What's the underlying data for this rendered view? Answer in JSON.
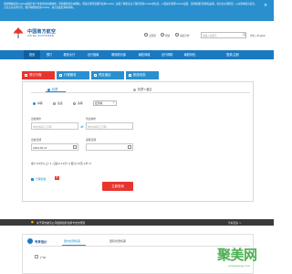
{
  "cookie_notice": {
    "text": "南航网站使用cookie来提升和个性化您的在线体验，若您继续浏览本网站，则表示您同意我们使用cookie。如需了解更多关于我们使用cookie的信息，以及如何管理cookie设置，请查看我们的隐私政策。请点击关闭按钮，以关闭本提示信息，无论点击关闭与否，我们将继续使用cookie。请点击此处查看详情。",
    "close_label": "×"
  },
  "header": {
    "logo_cn": "中国南方航空",
    "logo_en": "CHINA SOUTHERN",
    "links": [
      {
        "label": "无障碍"
      },
      {
        "label": "帮助"
      },
      {
        "label": "南航合作"
      }
    ],
    "search_placeholder": "请输入关键字",
    "language": "中文 | English"
  },
  "nav": {
    "items": [
      {
        "label": "首页"
      },
      {
        "label": "预订"
      },
      {
        "label": "服务大厅"
      },
      {
        "label": "出行指南"
      },
      {
        "label": "明珠俱乐部"
      },
      {
        "label": "南航商城"
      },
      {
        "label": "出行帮助"
      },
      {
        "label": "南航特色"
      }
    ],
    "login_label": "登录|注册"
  },
  "booking": {
    "tabs": [
      {
        "label": "预订行程"
      },
      {
        "label": "行程服务"
      },
      {
        "label": "预定酒店"
      },
      {
        "label": "航班动态"
      }
    ],
    "subtabs": [
      {
        "label": "机票"
      },
      {
        "label": "机票+酒店"
      }
    ],
    "trip_types": [
      {
        "label": "单程"
      },
      {
        "label": "往返"
      },
      {
        "label": "多程"
      }
    ],
    "cabin": "经济舱",
    "from_label": "出发城市",
    "from_placeholder": "中文/拼音/三字码",
    "to_label": "到达城市",
    "to_placeholder": "中文/拼音/三字码",
    "depart_label": "出发日期",
    "depart_value": "2024-05-27",
    "return_label": "返程日期",
    "return_placeholder": "",
    "pax_text": "成人(12岁以上) 1    儿童(2-11岁) 0    婴儿(14天-2岁) 0",
    "pax": [
      {
        "label": "成人",
        "value": "1"
      },
      {
        "label": "儿童",
        "value": "0"
      },
      {
        "label": "婴儿",
        "value": "0"
      }
    ],
    "option_label": "行程套餐",
    "option_badge": "新",
    "query_label": "立即查询"
  },
  "notice": {
    "text": "关于南方航空公司使用境外信用卡支付须知",
    "more": "查看更多 >"
  },
  "deals": {
    "title": "专享低价",
    "tabs": [
      {
        "label": "国内优惠机票"
      },
      {
        "label": "国际优惠机票"
      }
    ],
    "city": "广州"
  },
  "watermark": {
    "text": "聚美网",
    "sub": "jumeiwang.com"
  },
  "colors": {
    "brand_blue": "#1a79c0",
    "accent_red": "#e9342e",
    "logo_blue": "#13599a"
  }
}
